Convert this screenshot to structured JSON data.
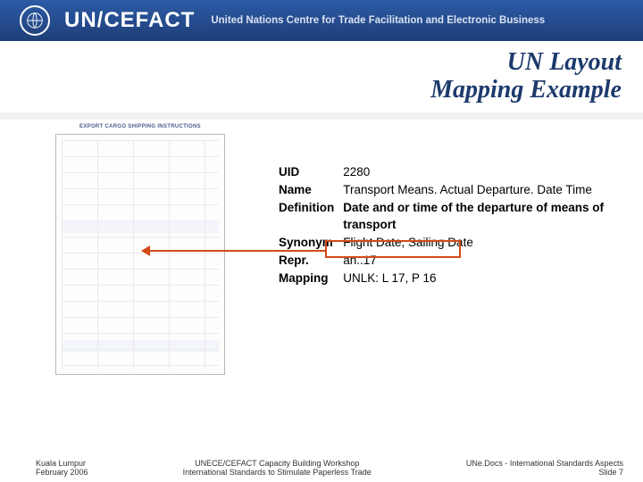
{
  "header": {
    "brand": "UN/CEFACT",
    "subtitle": "United Nations Centre for Trade Facilitation and Electronic Business"
  },
  "title": {
    "line1": "UN Layout",
    "line2": "Mapping Example"
  },
  "form": {
    "header": "EXPORT CARGO SHIPPING INSTRUCTIONS"
  },
  "fields": {
    "uid": {
      "label": "UID",
      "value": "2280"
    },
    "name": {
      "label": "Name",
      "value": "Transport Means. Actual Departure. Date Time"
    },
    "definition": {
      "label": "Definition",
      "value": "Date and or time of the departure of means of transport"
    },
    "synonym": {
      "label": "Synonym",
      "value": "Flight Date, Sailing Date"
    },
    "repr": {
      "label": "Repr.",
      "value": "an..17"
    },
    "mapping": {
      "label": "Mapping",
      "value": "UNLK: L 17, P 16"
    }
  },
  "footer": {
    "left_line1": "Kuala Lumpur",
    "left_line2": "February 2006",
    "mid_line1": "UNECE/CEFACT Capacity Building Workshop",
    "mid_line2": "International Standards to Stimulate Paperless Trade",
    "right_line1": "UNe.Docs - International Standards Aspects",
    "right_line2": "Slide 7"
  }
}
